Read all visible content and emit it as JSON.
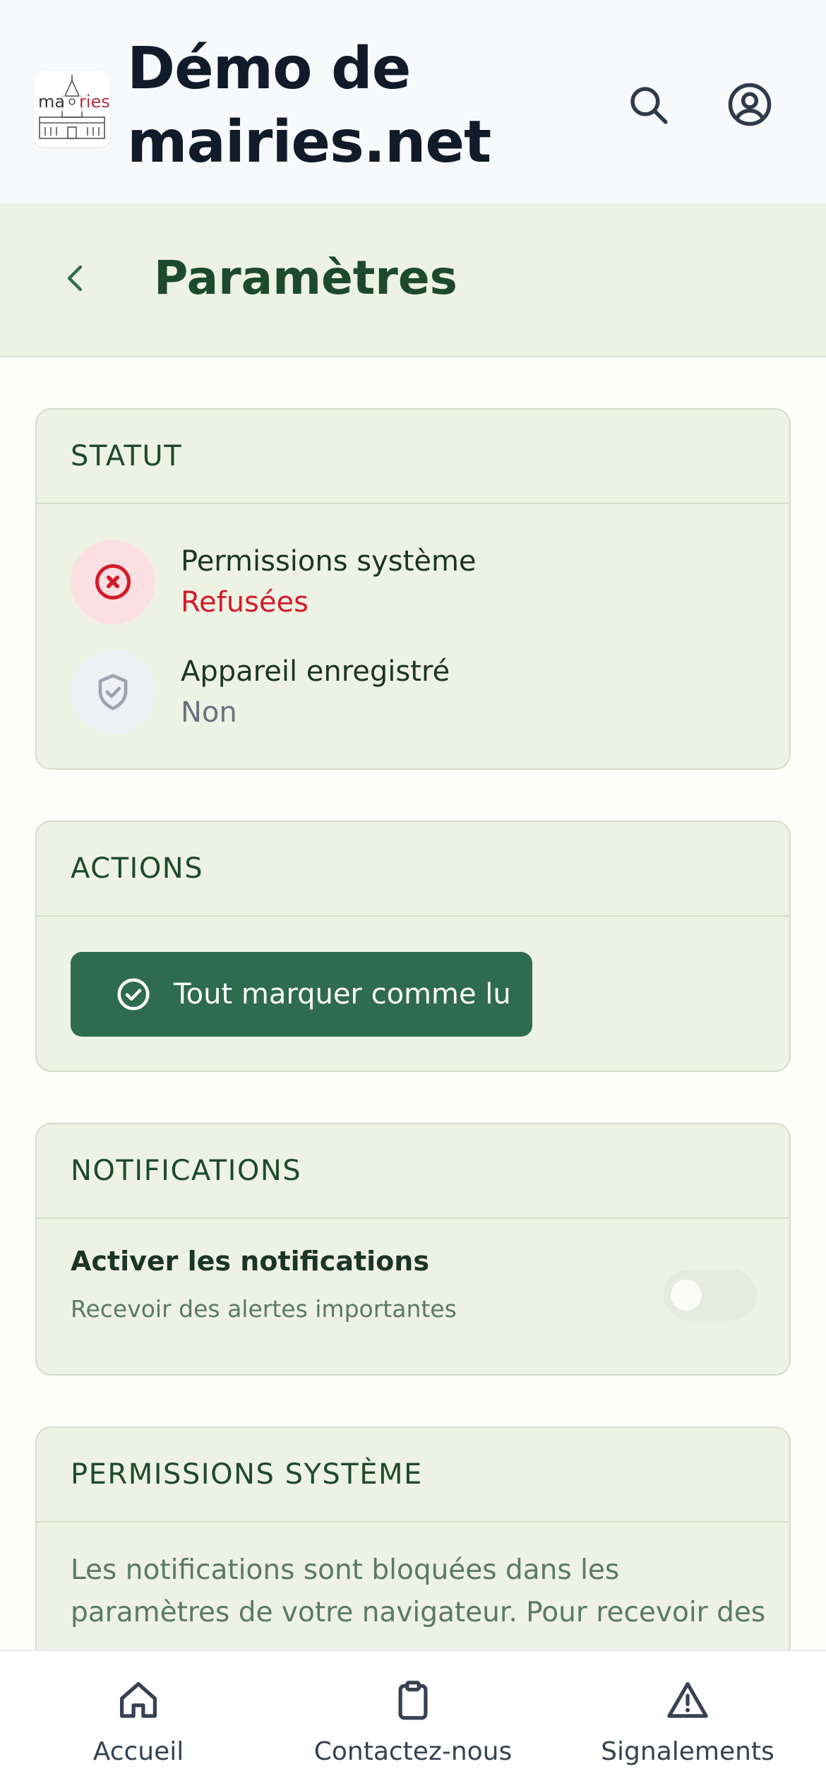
{
  "header": {
    "site_title": "Démo de mairies.net",
    "logo_text_left": "ma",
    "logo_text_right": "ries",
    "icons": [
      "search-icon",
      "account-icon"
    ]
  },
  "title_bar": {
    "title": "Paramètres",
    "back_icon": "chevron-left-icon"
  },
  "statut": {
    "heading": "STATUT",
    "items": [
      {
        "label": "Permissions système",
        "value": "Refusées",
        "icon": "x-circle-icon",
        "color": "#d31b2a"
      },
      {
        "label": "Appareil enregistré",
        "value": "Non",
        "icon": "shield-check-icon",
        "color": "#6b7280"
      }
    ]
  },
  "actions": {
    "heading": "ACTIONS",
    "mark_all_read": "Tout marquer comme lu",
    "button_color": "#2f6b4e"
  },
  "notifications": {
    "heading": "NOTIFICATIONS",
    "toggle_label": "Activer les notifications",
    "toggle_sub": "Recevoir des alertes importantes",
    "toggle_enabled": false
  },
  "permissions": {
    "heading": "PERMISSIONS SYSTÈME",
    "text": "Les notifications sont bloquées dans les paramètres de votre navigateur. Pour recevoir des"
  },
  "bottom_nav": {
    "items": [
      {
        "label": "Accueil",
        "icon": "home-icon"
      },
      {
        "label": "Contactez-nous",
        "icon": "clipboard-icon"
      },
      {
        "label": "Signalements",
        "icon": "warning-icon"
      }
    ]
  }
}
